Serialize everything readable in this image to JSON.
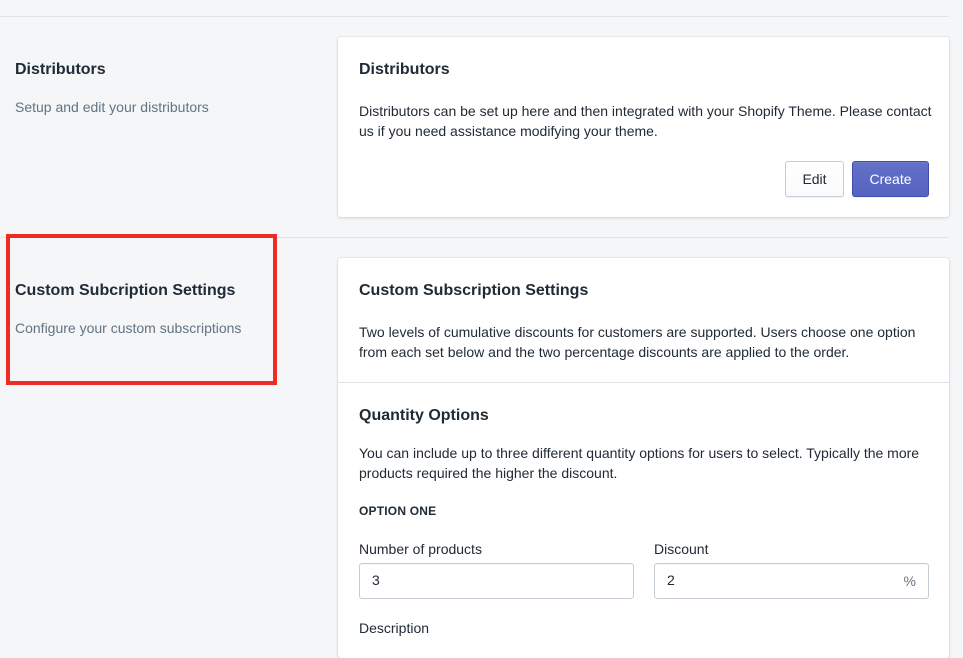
{
  "distributors_section": {
    "annotation_title": "Distributors",
    "annotation_description": "Setup and edit your distributors",
    "card_title": "Distributors",
    "card_text": "Distributors can be set up here and then integrated with your Shopify Theme. Please contact us if you need assistance modifying your theme.",
    "edit_label": "Edit",
    "create_label": "Create"
  },
  "subscription_section": {
    "annotation_title": "Custom Subcription Settings",
    "annotation_description": "Configure your custom subscriptions",
    "card_title": "Custom Subscription Settings",
    "card_text": "Two levels of cumulative discounts for customers are supported. Users choose one option from each set below and the two percentage discounts are applied to the order.",
    "quantity_options": {
      "title": "Quantity Options",
      "text": "You can include up to three different quantity options for users to select. Typically the more products required the higher the discount.",
      "option_heading": "OPTION ONE",
      "products_label": "Number of products",
      "products_value": "3",
      "discount_label": "Discount",
      "discount_value": "2",
      "discount_suffix": "%",
      "description_label": "Description"
    }
  },
  "colors": {
    "primary": "#5c6ac4",
    "highlight": "#ee2b24",
    "background": "#f4f6f8"
  }
}
